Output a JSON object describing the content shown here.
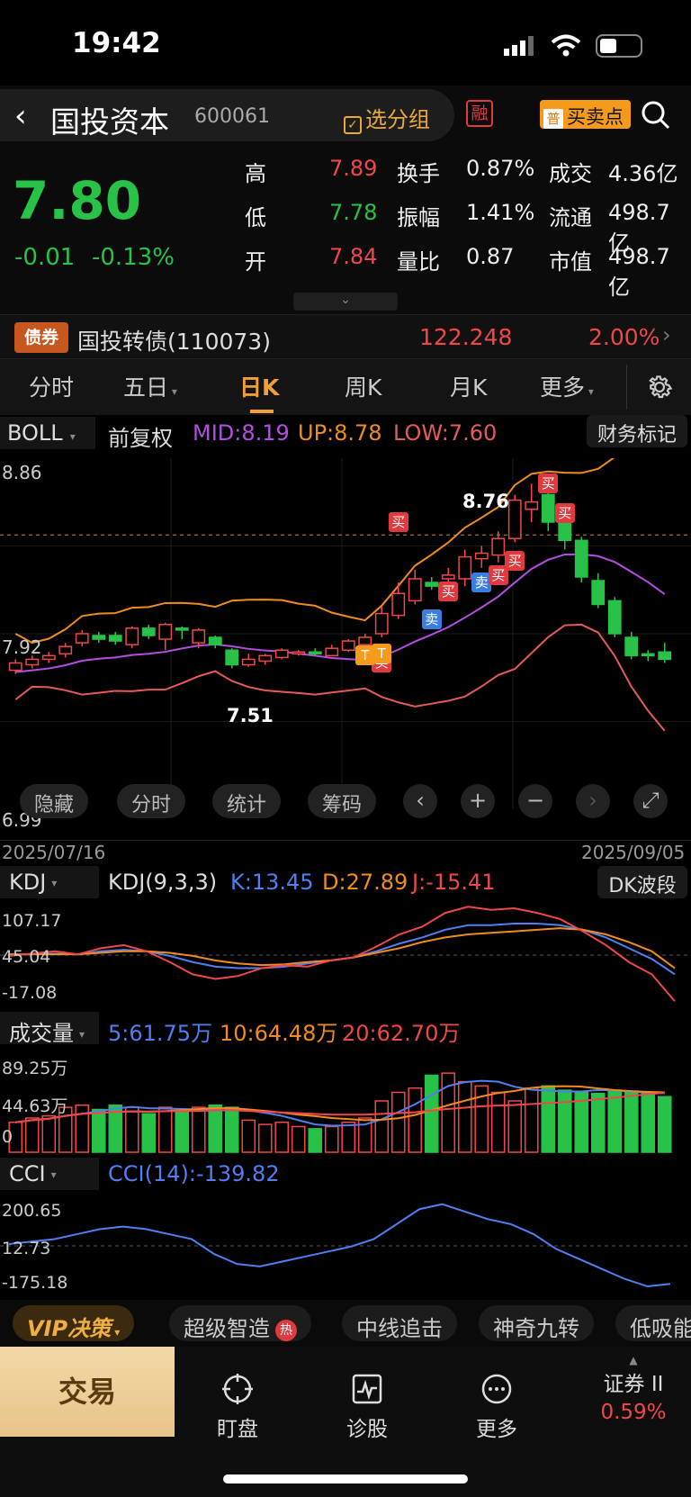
{
  "status": {
    "time": "19:42"
  },
  "header": {
    "stock_name": "国投资本",
    "stock_code": "600061",
    "group_button": "选分组",
    "margin_badge": "融",
    "signal_badge_icon": "普",
    "signal_button": "买卖点"
  },
  "quote": {
    "price": "7.80",
    "change": "-0.01",
    "change_pct": "-0.13%",
    "stats": [
      {
        "label": "高",
        "value": "7.89",
        "label2": "换手",
        "value2": "0.87%",
        "label3": "成交",
        "value3": "4.36亿"
      },
      {
        "label": "低",
        "value": "7.78",
        "label2": "振幅",
        "value2": "1.41%",
        "label3": "流通",
        "value3": "498.7亿"
      },
      {
        "label": "开",
        "value": "7.84",
        "label2": "量比",
        "value2": "0.87",
        "label3": "市值",
        "value3": "498.7亿"
      }
    ]
  },
  "bond": {
    "badge": "债券",
    "name": "国投转债(110073)",
    "price": "122.248",
    "pct": "2.00%"
  },
  "tabs": [
    "分时",
    "五日",
    "日K",
    "周K",
    "月K",
    "更多"
  ],
  "active_tab": "日K",
  "kchart": {
    "indicator": "BOLL",
    "adjust": "前复权",
    "mid": "MID:8.19",
    "up": "UP:8.78",
    "low": "LOW:7.60",
    "finance_button": "财务标记",
    "y_top": "8.86",
    "y_mid": "7.92",
    "y_bottom": "6.99",
    "high_label": "8.76",
    "low_label": "7.51",
    "date_start": "2025/07/16",
    "date_end": "2025/09/05",
    "buttons": [
      "隐藏",
      "分时",
      "统计",
      "筹码"
    ],
    "tag_buy": "买",
    "tag_sell": "卖",
    "tag_t": "T"
  },
  "kdj": {
    "name": "KDJ",
    "params": "KDJ(9,3,3)",
    "k": "K:13.45",
    "d": "D:27.89",
    "j": "J:-15.41",
    "button": "DK波段",
    "y_top": "107.17",
    "y_mid": "45.04",
    "y_bottom": "-17.08"
  },
  "volume": {
    "name": "成交量",
    "ma5": "5:61.75万",
    "ma10": "10:64.48万",
    "ma20": "20:62.70万",
    "y_top": "89.25万",
    "y_mid": "44.63万",
    "y_bottom": "0"
  },
  "cci": {
    "name": "CCI",
    "value": "CCI(14):-139.82",
    "y_top": "200.65",
    "y_mid": "12.73",
    "y_bottom": "-175.18"
  },
  "strategy": {
    "vip": "VIP决策",
    "chips": [
      "超级智造",
      "中线追击",
      "神奇九转",
      "低吸能"
    ],
    "hot": "热"
  },
  "nav": {
    "trade": "交易",
    "items": [
      "盯盘",
      "诊股",
      "更多"
    ],
    "index_name": "证券 II",
    "index_pct": "0.59%"
  },
  "colors": {
    "up": "#f1474a",
    "down": "#27c247",
    "mid": "#b34fe0",
    "upper": "#f08c1e",
    "lower": "#e55a5a",
    "k": "#4f7ff0",
    "d": "#f08c1e",
    "j": "#f1474a",
    "cci": "#4f7ff0"
  },
  "chart_data": [
    {
      "type": "candlestick",
      "title": "BOLL",
      "ylim": [
        6.99,
        8.86
      ],
      "candles": [
        [
          7.74,
          7.78,
          7.72,
          7.8
        ],
        [
          7.77,
          7.8,
          7.75,
          7.82
        ],
        [
          7.8,
          7.82,
          7.78,
          7.84
        ],
        [
          7.83,
          7.87,
          7.81,
          7.89
        ],
        [
          7.89,
          7.94,
          7.87,
          7.96
        ],
        [
          7.93,
          7.91,
          7.89,
          7.95
        ],
        [
          7.93,
          7.9,
          7.88,
          7.95
        ],
        [
          7.88,
          7.97,
          7.86,
          7.98
        ],
        [
          7.97,
          7.93,
          7.91,
          7.99
        ],
        [
          7.91,
          7.99,
          7.85,
          8.0
        ],
        [
          7.97,
          7.96,
          7.91,
          7.98
        ],
        [
          7.89,
          7.96,
          7.86,
          7.97
        ],
        [
          7.92,
          7.88,
          7.86,
          7.93
        ],
        [
          7.85,
          7.77,
          7.75,
          7.86
        ],
        [
          7.77,
          7.8,
          7.76,
          7.83
        ],
        [
          7.79,
          7.82,
          7.77,
          7.83
        ],
        [
          7.81,
          7.85,
          7.8,
          7.86
        ],
        [
          7.84,
          7.84,
          7.82,
          7.85
        ],
        [
          7.84,
          7.83,
          7.82,
          7.86
        ],
        [
          7.82,
          7.86,
          7.82,
          7.88
        ],
        [
          7.85,
          7.9,
          7.84,
          7.91
        ],
        [
          7.88,
          7.92,
          7.86,
          7.94
        ],
        [
          7.94,
          8.05,
          7.92,
          8.09
        ],
        [
          8.04,
          8.16,
          8.02,
          8.22
        ],
        [
          8.12,
          8.24,
          8.1,
          8.29
        ],
        [
          8.22,
          8.2,
          8.18,
          8.25
        ],
        [
          8.24,
          8.26,
          8.2,
          8.3
        ],
        [
          8.24,
          8.36,
          8.2,
          8.4
        ],
        [
          8.35,
          8.38,
          8.3,
          8.42
        ],
        [
          8.37,
          8.46,
          8.33,
          8.5
        ],
        [
          8.46,
          8.67,
          8.44,
          8.7
        ],
        [
          8.62,
          8.66,
          8.55,
          8.76
        ],
        [
          8.7,
          8.55,
          8.5,
          8.73
        ],
        [
          8.55,
          8.45,
          8.4,
          8.6
        ],
        [
          8.45,
          8.25,
          8.22,
          8.47
        ],
        [
          8.23,
          8.1,
          8.08,
          8.27
        ],
        [
          8.12,
          7.94,
          7.92,
          8.14
        ],
        [
          7.92,
          7.82,
          7.8,
          7.95
        ],
        [
          7.83,
          7.82,
          7.79,
          7.85
        ],
        [
          7.84,
          7.8,
          7.78,
          7.89
        ]
      ],
      "boll_mid_last": 8.19,
      "boll_up_last": 8.78,
      "boll_low_last": 7.6
    },
    {
      "type": "line",
      "title": "KDJ(9,3,3)",
      "series": [
        {
          "name": "K",
          "values": [
            45,
            46,
            47,
            46,
            50,
            52,
            50,
            44,
            36,
            30,
            28,
            28,
            30,
            34,
            38,
            42,
            50,
            60,
            68,
            78,
            84,
            84,
            86,
            86,
            84,
            78,
            68,
            54,
            40,
            20
          ]
        },
        {
          "name": "D",
          "values": [
            46,
            46,
            46,
            46,
            48,
            50,
            50,
            48,
            44,
            38,
            34,
            32,
            33,
            36,
            38,
            42,
            48,
            54,
            62,
            68,
            72,
            74,
            76,
            78,
            80,
            78,
            72,
            62,
            50,
            28
          ]
        },
        {
          "name": "J",
          "values": [
            44,
            47,
            50,
            46,
            54,
            58,
            50,
            36,
            20,
            14,
            18,
            28,
            32,
            30,
            38,
            42,
            56,
            72,
            82,
            100,
            108,
            104,
            106,
            100,
            92,
            76,
            58,
            36,
            20,
            -15
          ]
        }
      ]
    },
    {
      "type": "bar",
      "title": "成交量",
      "series": [
        {
          "name": "5",
          "value_last": "61.75万"
        },
        {
          "name": "10",
          "value_last": "64.48万"
        },
        {
          "name": "20",
          "value_last": "62.70万"
        }
      ]
    },
    {
      "type": "line",
      "title": "CCI(14)",
      "series": [
        {
          "name": "CCI",
          "values": [
            20,
            30,
            40,
            60,
            80,
            90,
            80,
            60,
            40,
            -20,
            -60,
            -70,
            -50,
            -30,
            -10,
            10,
            40,
            100,
            160,
            180,
            150,
            120,
            100,
            60,
            0,
            -40,
            -80,
            -120,
            -150,
            -140
          ]
        }
      ]
    }
  ]
}
